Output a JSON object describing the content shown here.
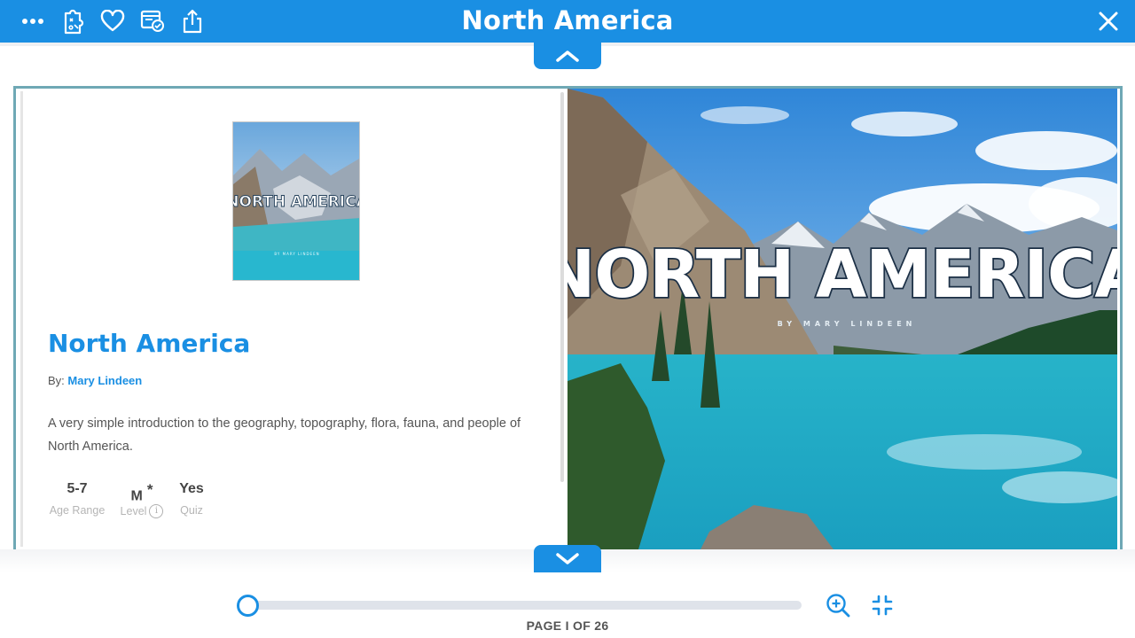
{
  "header": {
    "title": "North America",
    "icons": [
      "more-icon",
      "puzzle-icon",
      "heart-icon",
      "assign-icon",
      "share-icon",
      "close-icon"
    ]
  },
  "book": {
    "title": "North America",
    "by_label": "By:",
    "author": "Mary Lindeen",
    "description": "A very simple introduction to the geography, topography, flora, fauna, and people of North America.",
    "stats": [
      {
        "value": "5-7",
        "label": "Age Range"
      },
      {
        "value": "M",
        "marker": "*",
        "label": "Level"
      },
      {
        "value": "Yes",
        "label": "Quiz"
      }
    ],
    "cover_title": "NORTH AMERICA",
    "cover_byline": "BY MARY LINDEEN"
  },
  "footer": {
    "page_indicator": "PAGE I OF 26",
    "progress": 0
  },
  "colors": {
    "accent": "#1a8fe3",
    "frame": "#6fa8b5",
    "water": "#1fb6cf"
  }
}
